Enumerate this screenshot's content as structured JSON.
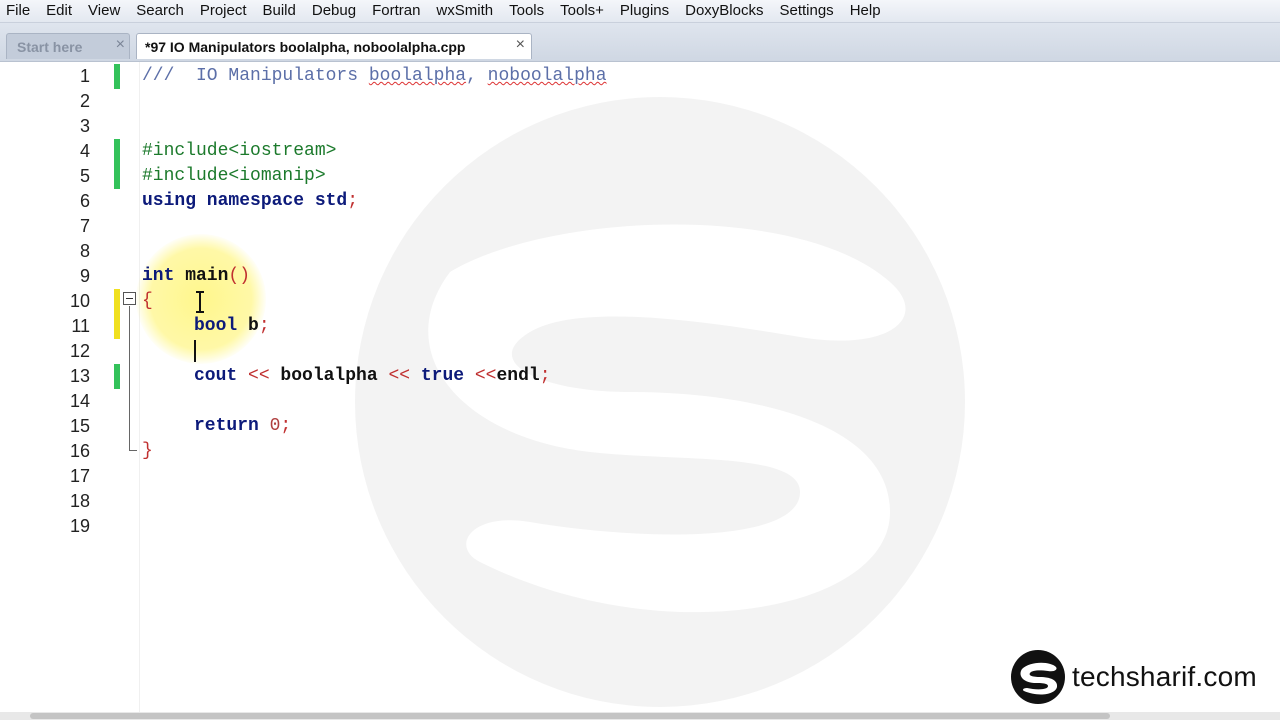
{
  "menu": [
    "File",
    "Edit",
    "View",
    "Search",
    "Project",
    "Build",
    "Debug",
    "Fortran",
    "wxSmith",
    "Tools",
    "Tools+",
    "Plugins",
    "DoxyBlocks",
    "Settings",
    "Help"
  ],
  "tabs": {
    "inactive": {
      "label": "Start here",
      "close": "×"
    },
    "active": {
      "label": "*97 IO Manipulators boolalpha, noboolalpha.cpp",
      "close": "×"
    }
  },
  "editor": {
    "line_numbers": [
      "1",
      "2",
      "3",
      "4",
      "5",
      "6",
      "7",
      "8",
      "9",
      "10",
      "11",
      "12",
      "13",
      "14",
      "15",
      "16",
      "17",
      "18",
      "19"
    ],
    "code": {
      "l1_comment": "///  IO Manipulators ",
      "l1_word1": "boolalpha",
      "l1_sep": ", ",
      "l1_word2": "noboolalpha",
      "l4": "#include<iostream>",
      "l5": "#include<iomanip>",
      "l6_kw": "using namespace",
      "l6_rest": " std",
      "l6_semi": ";",
      "l9_kw": "int",
      "l9_name": " main",
      "l9_parens": "()",
      "l10": "{",
      "l11_kw": "bool",
      "l11_rest": " b",
      "l11_semi": ";",
      "l13_a": "cout ",
      "l13_op1": "<<",
      "l13_b": " boolalpha ",
      "l13_op2": "<<",
      "l13_c": " true ",
      "l13_op3": "<<",
      "l13_d": "endl",
      "l13_semi": ";",
      "l15_kw": "return",
      "l15_num": " 0",
      "l15_semi": ";",
      "l16": "}"
    }
  },
  "logo": {
    "text": "techsharif.com"
  },
  "colors": {
    "comment": "#5c6fa8",
    "preprocessor": "#1c7a2c",
    "keyword": "#0c1a7a",
    "operator": "#c03030",
    "change_saved": "#33c25a",
    "change_unsaved": "#f0e020",
    "cursor_highlight": "#fff578"
  }
}
